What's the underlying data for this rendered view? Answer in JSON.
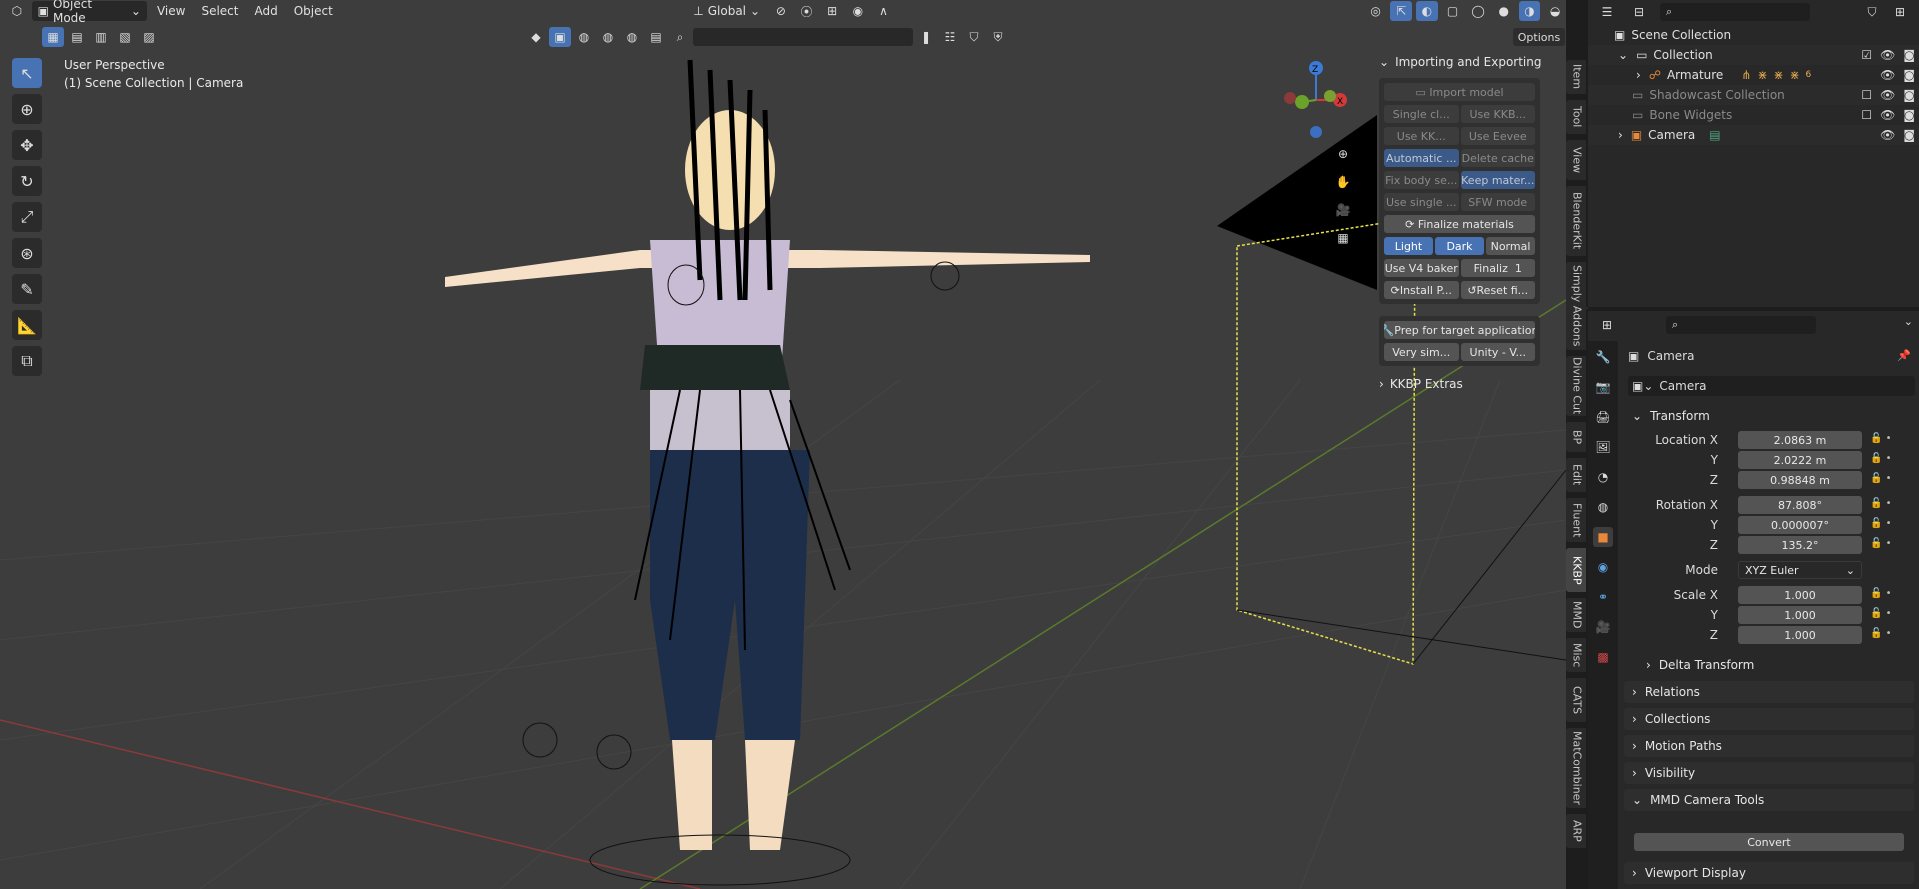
{
  "header": {
    "mode": "Object Mode",
    "menus": [
      "View",
      "Select",
      "Add",
      "Object"
    ],
    "orientation": "Global",
    "options": "Options"
  },
  "overlay_text": {
    "perspective": "User Perspective",
    "collection": "(1) Scene Collection | Camera"
  },
  "npanel": {
    "section_title": "Importing and Exporting",
    "import_model": "Import model",
    "rows": [
      [
        "Single cl...",
        "Use KKB..."
      ],
      [
        "Use KK...",
        "Use Eevee"
      ],
      [
        "Automatic ...",
        "Delete cache"
      ],
      [
        "Fix body se...",
        "Keep mater..."
      ],
      [
        "Use single ...",
        "SFW mode"
      ]
    ],
    "finalize": "Finalize materials",
    "theme_buttons": [
      "Light",
      "Dark",
      "Normal"
    ],
    "v4_baker": "Use V4 baker",
    "finaliz_label": "Finaliz",
    "finaliz_value": "1",
    "install": "Install P...",
    "reset": "Reset fi...",
    "prep": "Prep for target application",
    "prep_opt1": "Very sim...",
    "prep_opt2": "Unity - V...",
    "extras": "KKBP Extras"
  },
  "side_tabs": [
    "Item",
    "Tool",
    "View",
    "BlenderKit",
    "Simply Addons",
    "Divine Cut",
    "BP",
    "Edit",
    "Fluent",
    "KKBP",
    "MMD",
    "Misc",
    "CATS",
    "MatCombiner",
    "ARP"
  ],
  "outliner": {
    "root": "Scene Collection",
    "items": [
      {
        "label": "Collection",
        "indent": 1
      },
      {
        "label": "Armature",
        "indent": 2
      },
      {
        "label": "Shadowcast Collection",
        "indent": 1
      },
      {
        "label": "Bone Widgets",
        "indent": 1
      },
      {
        "label": "Camera",
        "indent": 1
      }
    ],
    "armature_badge": "6"
  },
  "properties": {
    "object_name_top": "Camera",
    "object_name_field": "Camera",
    "transform": "Transform",
    "location": {
      "label_x": "Location X",
      "x": "2.0863 m",
      "y": "2.0222 m",
      "z": "0.98848 m"
    },
    "rotation": {
      "label_x": "Rotation X",
      "x": "87.808°",
      "y": "0.000007°",
      "z": "135.2°"
    },
    "mode_label": "Mode",
    "mode": "XYZ Euler",
    "scale": {
      "label_x": "Scale X",
      "x": "1.000",
      "y": "1.000",
      "z": "1.000"
    },
    "y": "Y",
    "z": "Z",
    "delta": "Delta Transform",
    "panels": [
      "Relations",
      "Collections",
      "Motion Paths",
      "Visibility",
      "MMD Camera Tools"
    ],
    "convert": "Convert",
    "viewport_display": "Viewport Display"
  },
  "colors": {
    "accent": "#4772b3",
    "viewport": "#3d3d3d",
    "panel": "#282828"
  }
}
